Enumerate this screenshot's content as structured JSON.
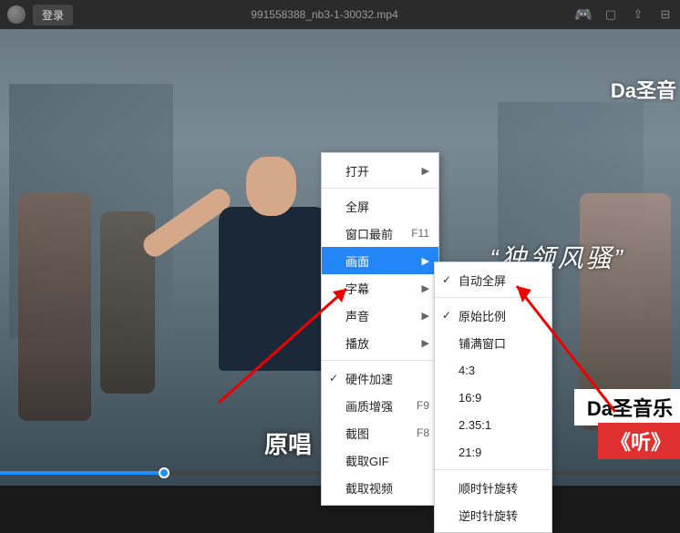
{
  "titlebar": {
    "login": "登录",
    "filename": "991558388_nb3-1-30032.mp4"
  },
  "overlay": {
    "top_right": "Da圣音",
    "quote": "“独领风骚”",
    "box_white": "Da圣音乐",
    "box_red": "《听》",
    "subtitle": "原唱"
  },
  "menu1": {
    "open": "打开",
    "fullscreen": "全屏",
    "ontop": "窗口最前",
    "ontop_sc": "F11",
    "picture": "画面",
    "subtitle": "字幕",
    "sound": "声音",
    "play": "播放",
    "hwaccel": "硬件加速",
    "enhance": "画质增强",
    "enhance_sc": "F9",
    "screenshot": "截图",
    "screenshot_sc": "F8",
    "gif": "截取GIF",
    "clip": "截取视频"
  },
  "menu2": {
    "auto_fs": "自动全屏",
    "orig": "原始比例",
    "fill": "铺满窗口",
    "r43": "4:3",
    "r169": "16:9",
    "r2351": "2.35:1",
    "r219": "21:9",
    "rot_cw": "顺时针旋转",
    "rot_ccw": "逆时针旋转"
  }
}
